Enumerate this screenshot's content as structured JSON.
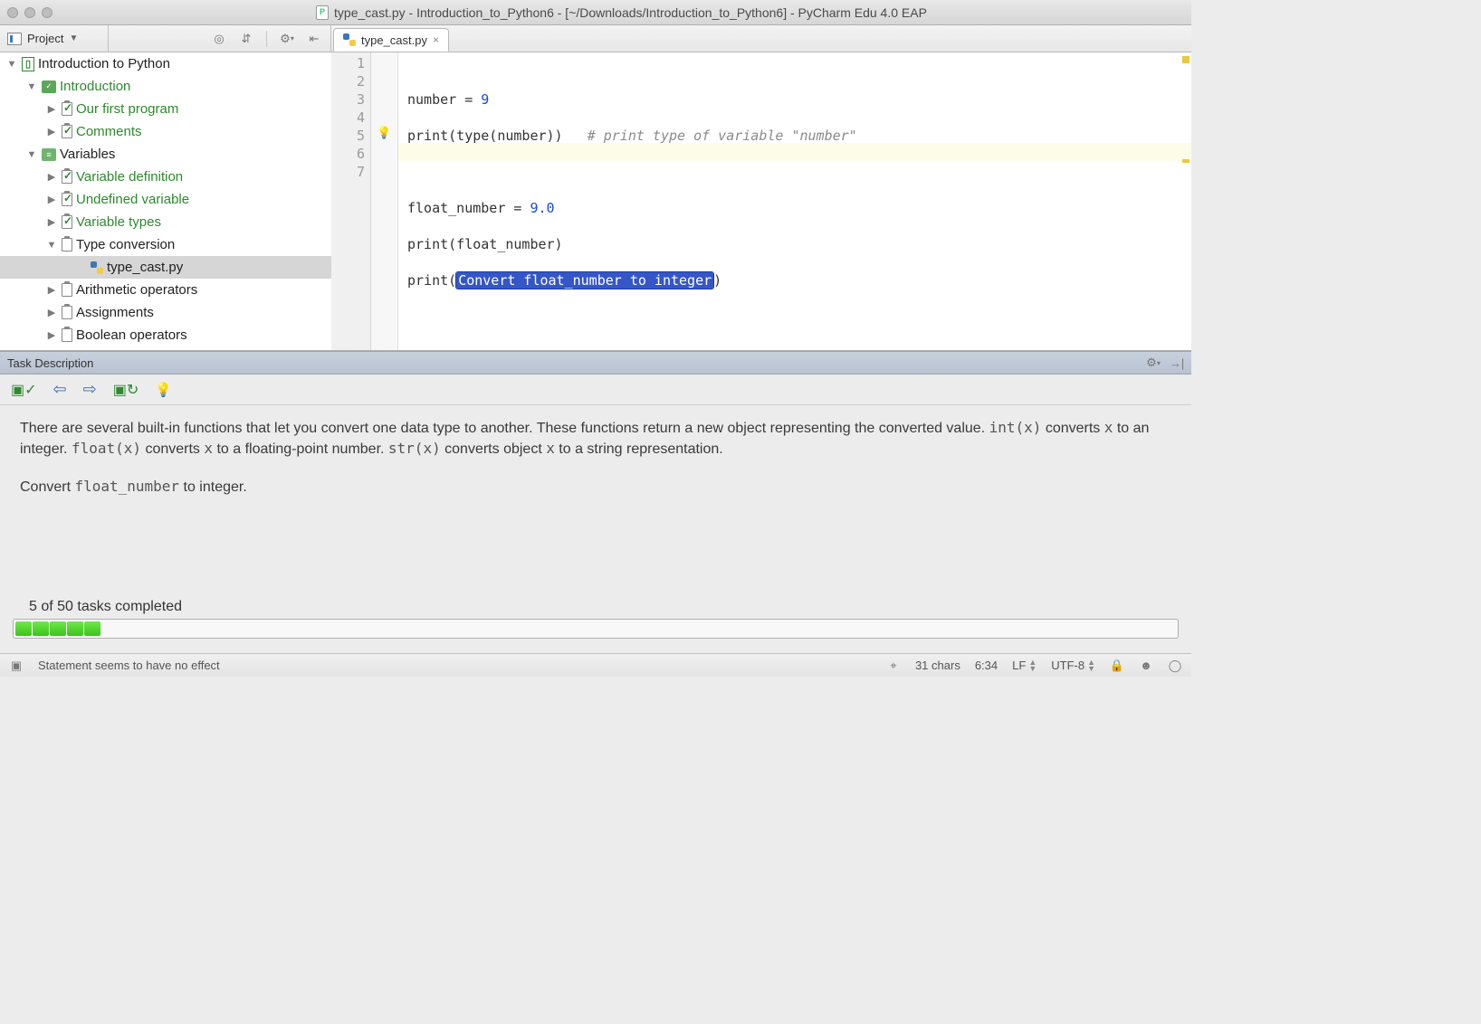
{
  "window": {
    "title": "type_cast.py - Introduction_to_Python6 - [~/Downloads/Introduction_to_Python6] - PyCharm Edu 4.0 EAP"
  },
  "toolbar": {
    "project_label": "Project"
  },
  "tab": {
    "file": "type_cast.py"
  },
  "tree": {
    "root": "Introduction to Python",
    "l1": "Introduction",
    "l1a": "Our first program",
    "l1b": "Comments",
    "l2": "Variables",
    "l2a": "Variable definition",
    "l2b": "Undefined variable",
    "l2c": "Variable types",
    "l2d": "Type conversion",
    "l2d1": "type_cast.py",
    "l2e": "Arithmetic operators",
    "l2f": "Assignments",
    "l2g": "Boolean operators"
  },
  "code": {
    "l1a": "number = ",
    "l1b": "9",
    "l2a": "print(type(number))   ",
    "l2b": "# print type of variable \"number\"",
    "l4a": "float_number = ",
    "l4b": "9.0",
    "l5": "print(float_number)",
    "l6a": "print(",
    "l6b": "Convert float_number to integer",
    "l6c": ")",
    "gutter": [
      "1",
      "2",
      "3",
      "4",
      "5",
      "6",
      "7"
    ]
  },
  "task": {
    "header": "Task Description",
    "body_p1a": "There are several built-in functions that let you convert one data type to another. These functions return a new object representing the converted value. ",
    "int": "int(x)",
    "body_p1b": " converts ",
    "x1": "x",
    "body_p1c": " to an integer. ",
    "float": "float(x)",
    "body_p1d": " converts ",
    "x2": "x",
    "body_p1e": " to a floating-point number. ",
    "str": "str(x)",
    "body_p1f": " converts object ",
    "x3": "x",
    "body_p1g": " to a string representation.",
    "body_p2a": "Convert ",
    "fn": "float_number",
    "body_p2b": " to integer."
  },
  "progress": {
    "label": "5 of 50 tasks completed",
    "done": 5
  },
  "status": {
    "msg": "Statement seems to have no effect",
    "chars": "31 chars",
    "pos": "6:34",
    "eol": "LF",
    "enc": "UTF-8"
  }
}
